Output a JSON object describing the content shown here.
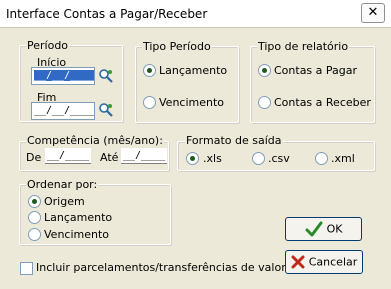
{
  "window": {
    "title": "Interface Contas a Pagar/Receber",
    "close_glyph": "✕"
  },
  "periodo": {
    "legend": "Período",
    "inicio_label": "Início",
    "inicio_value": "__/__/____",
    "fim_label": "Fim",
    "fim_value": "__/__/____",
    "search_icon": "search-icon"
  },
  "tipo_periodo": {
    "legend": "Tipo Período",
    "options": [
      "Lançamento",
      "Vencimento"
    ],
    "selected": "Lançamento"
  },
  "tipo_relatorio": {
    "legend": "Tipo de relatório",
    "options": [
      "Contas a Pagar",
      "Contas a Receber"
    ],
    "selected": "Contas a Pagar"
  },
  "competencia": {
    "legend": "Competência (mês/ano):",
    "de_label": "De",
    "de_value": "__/____",
    "ate_label": "Até",
    "ate_value": "__/____"
  },
  "formato": {
    "legend": "Formato de saída",
    "options": [
      ".xls",
      ".csv",
      ".xml"
    ],
    "selected": ".xls"
  },
  "ordenar": {
    "legend": "Ordenar por:",
    "options": [
      "Origem",
      "Lançamento",
      "Vencimento"
    ],
    "selected": "Origem"
  },
  "incluir": {
    "label": "Incluir parcelamentos/transferências de valor",
    "checked": false
  },
  "buttons": {
    "ok_label": "OK",
    "cancel_label": "Cancelar"
  },
  "colors": {
    "ok_icon": "#2a8a2a",
    "cancel_icon": "#c0281c",
    "selection": "#316ac5"
  }
}
